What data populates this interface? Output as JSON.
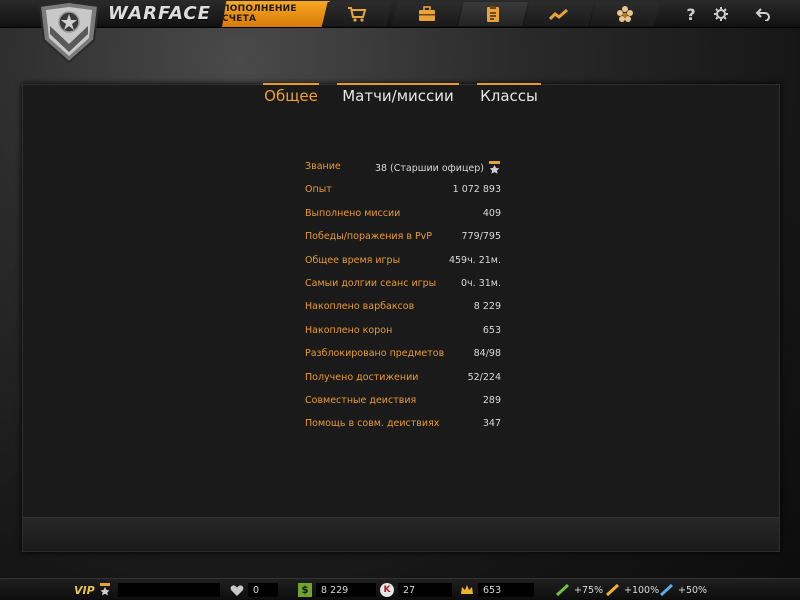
{
  "header": {
    "brand": "WARFACE",
    "topup_label": "ПОПОЛНЕНИЕ СЧЕТА",
    "nav_icons": [
      "cart-icon",
      "briefcase-icon",
      "clipboard-icon",
      "chart-icon",
      "flower-icon"
    ],
    "help_label": "?"
  },
  "tabs": [
    {
      "label": "Общее",
      "active": true
    },
    {
      "label": "Матчи/миссии",
      "active": false
    },
    {
      "label": "Классы",
      "active": false
    }
  ],
  "stats": [
    {
      "label": "Звание",
      "value": "38 (Старшии офицер)"
    },
    {
      "label": "Опыт",
      "value": "1 072 893"
    },
    {
      "label": "Выполнено миссии",
      "value": "409"
    },
    {
      "label": "Победы/поражения в PvP",
      "value": "779/795"
    },
    {
      "label": "Общее время игры",
      "value": "459ч. 21м."
    },
    {
      "label": "Самыи долгии сеанс игры",
      "value": "0ч. 31м."
    },
    {
      "label": "Накоплено варбаксов",
      "value": "8 229"
    },
    {
      "label": "Накоплено корон",
      "value": "653"
    },
    {
      "label": "Разблокировано предметов",
      "value": "84/98"
    },
    {
      "label": "Получено достижении",
      "value": "52/224"
    },
    {
      "label": "Совместные деиствия",
      "value": "289"
    },
    {
      "label": "Помощь в совм. деиствиях",
      "value": "347"
    }
  ],
  "footer": {
    "vip": "VIP",
    "hearts": "0",
    "warbucks": "8 229",
    "kredits": "27",
    "crowns": "653",
    "boost_xp": "+75%",
    "boost_money": "+100%",
    "boost_vp": "+50%"
  },
  "colors": {
    "accent": "#e79a34",
    "topup": "#f39c1e"
  }
}
